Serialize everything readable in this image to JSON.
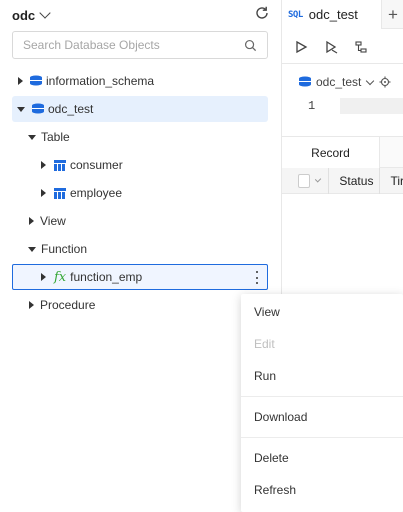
{
  "sidebar": {
    "db_name": "odc",
    "search_placeholder": "Search Database Objects",
    "tree": {
      "info_schema": "information_schema",
      "odc_test": "odc_test",
      "table": "Table",
      "consumer": "consumer",
      "employee": "employee",
      "view": "View",
      "function": "Function",
      "function_emp": "function_emp",
      "procedure": "Procedure"
    }
  },
  "editor": {
    "tab_icon": "SQL",
    "tab_label": "odc_test",
    "add_tab": "+",
    "db_selector": "odc_test",
    "line_number": "1",
    "result_tab": "Record",
    "columns": [
      "Status",
      "Tir"
    ]
  },
  "context_menu": {
    "items": [
      {
        "label": "View",
        "enabled": true
      },
      {
        "label": "Edit",
        "enabled": false
      },
      {
        "label": "Run",
        "enabled": true
      },
      {
        "label": "Download",
        "enabled": true
      },
      {
        "label": "Delete",
        "enabled": true
      },
      {
        "label": "Refresh",
        "enabled": true
      }
    ]
  },
  "colors": {
    "accent": "#1f6bde",
    "selected_bg": "#e6f0fd",
    "fx_green": "#35a735"
  }
}
